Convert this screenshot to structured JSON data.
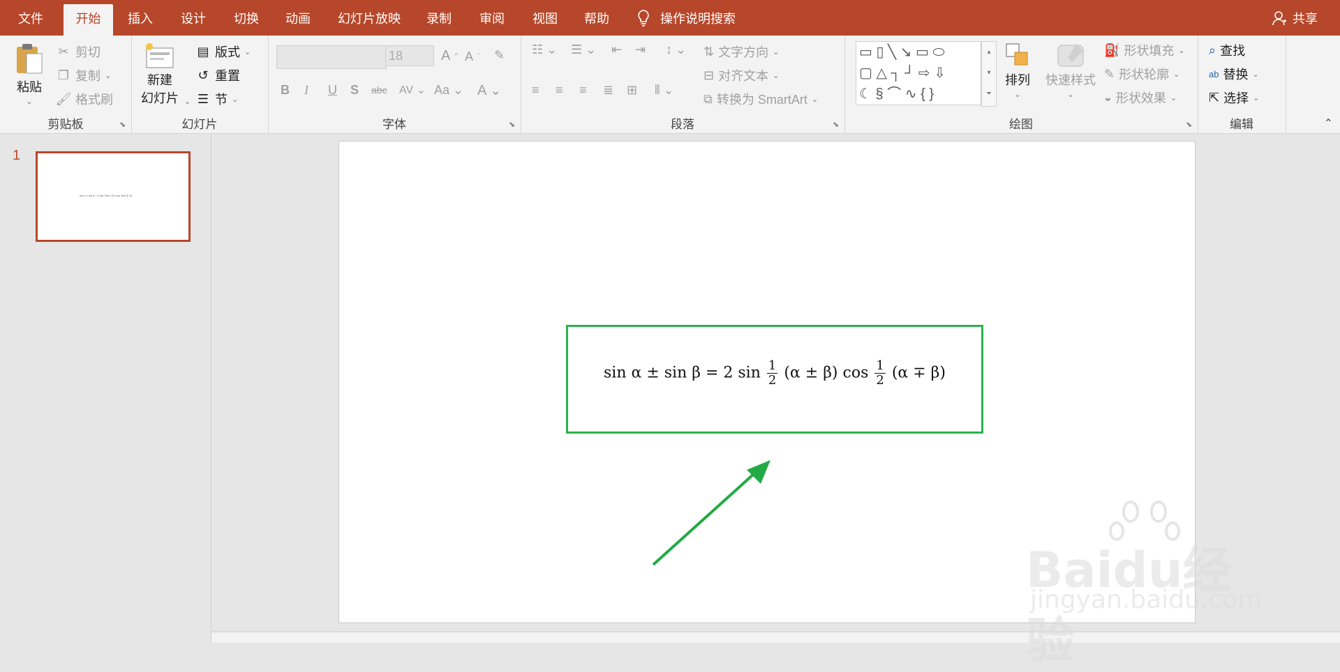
{
  "tabs": [
    {
      "label": "文件",
      "active": false
    },
    {
      "label": "开始",
      "active": true
    },
    {
      "label": "插入",
      "active": false
    },
    {
      "label": "设计",
      "active": false
    },
    {
      "label": "切换",
      "active": false
    },
    {
      "label": "动画",
      "active": false
    },
    {
      "label": "幻灯片放映",
      "active": false
    },
    {
      "label": "录制",
      "active": false
    },
    {
      "label": "审阅",
      "active": false
    },
    {
      "label": "视图",
      "active": false
    },
    {
      "label": "帮助",
      "active": false
    }
  ],
  "search": {
    "icon": "lightbulb-icon",
    "label": "操作说明搜索"
  },
  "share": {
    "icon": "person-icon",
    "label": "共享"
  },
  "ribbon": {
    "clipboard": {
      "label": "剪贴板",
      "paste": "粘贴",
      "cut": "剪切",
      "copy": "复制",
      "format_painter": "格式刷"
    },
    "slides": {
      "label": "幻灯片",
      "new_slide_1": "新建",
      "new_slide_2": "幻灯片",
      "layout": "版式",
      "reset": "重置",
      "section": "节"
    },
    "font": {
      "label": "字体",
      "font_name": "",
      "font_size": "18"
    },
    "paragraph": {
      "label": "段落",
      "text_direction": "文字方向",
      "align_text": "对齐文本",
      "smartart": "转换为 SmartArt"
    },
    "drawing": {
      "label": "绘图",
      "arrange": "排列",
      "quick_styles": "快速样式",
      "shape_fill": "形状填充",
      "shape_outline": "形状轮廓",
      "shape_effects": "形状效果"
    },
    "editing": {
      "label": "编辑",
      "find": "查找",
      "replace": "替换",
      "select": "选择"
    }
  },
  "slides_pane": {
    "slide_number": "1"
  },
  "slide": {
    "equation": {
      "part1": "sin α ± sin β = 2 sin",
      "frac_num": "1",
      "frac_den": "2",
      "part2": "(α ± β) cos",
      "part3": "(α ∓ β)"
    }
  },
  "watermark": {
    "brand_en": "Bai",
    "brand_du": "du",
    "brand_cn": "经验",
    "url": "jingyan.baidu.com"
  },
  "colors": {
    "accent": "#b7472a",
    "highlight": "#2bb34a"
  }
}
